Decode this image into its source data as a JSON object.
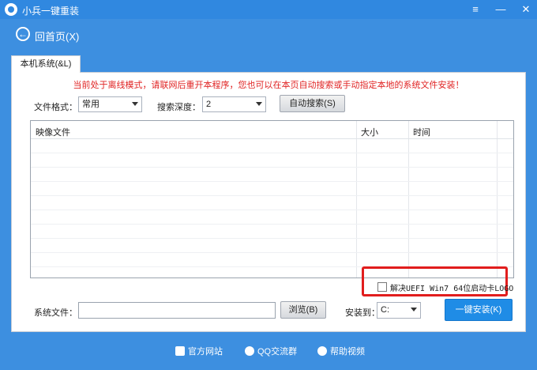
{
  "window": {
    "title": "小兵一键重装",
    "controls": {
      "menu": "≡",
      "minimize": "—",
      "close": "✕"
    }
  },
  "nav": {
    "back_label": "回首页(X)"
  },
  "tabs": [
    {
      "label": "本机系统(&L)"
    }
  ],
  "notice": "当前处于离线模式，请联网后重开本程序，您也可以在本页自动搜索或手动指定本地的系统文件安装！",
  "filters": {
    "format_label": "文件格式：",
    "format_value": "常用",
    "depth_label": "搜索深度：",
    "depth_value": "2",
    "auto_search_label": "自动搜索(S)"
  },
  "table": {
    "columns": [
      "映像文件",
      "大小",
      "时间"
    ],
    "rows": []
  },
  "options": {
    "uefi_logo_label": "解决UEFI Win7 64位启动卡LOGO",
    "uefi_logo_checked": false
  },
  "install": {
    "system_file_label": "系统文件：",
    "system_file_value": "",
    "browse_label": "浏览(B)",
    "install_to_label": "安装到：",
    "install_to_value": "C:",
    "one_click_label": "一键安装(K)"
  },
  "footer": {
    "links": [
      "官方网站",
      "QQ交流群",
      "帮助视频"
    ]
  },
  "colors": {
    "title_bar": "#3088e0",
    "background": "#3d8fe0",
    "notice_text": "#e02424",
    "highlight_border": "#e11d1d",
    "primary_button": "#1f8ce6"
  }
}
